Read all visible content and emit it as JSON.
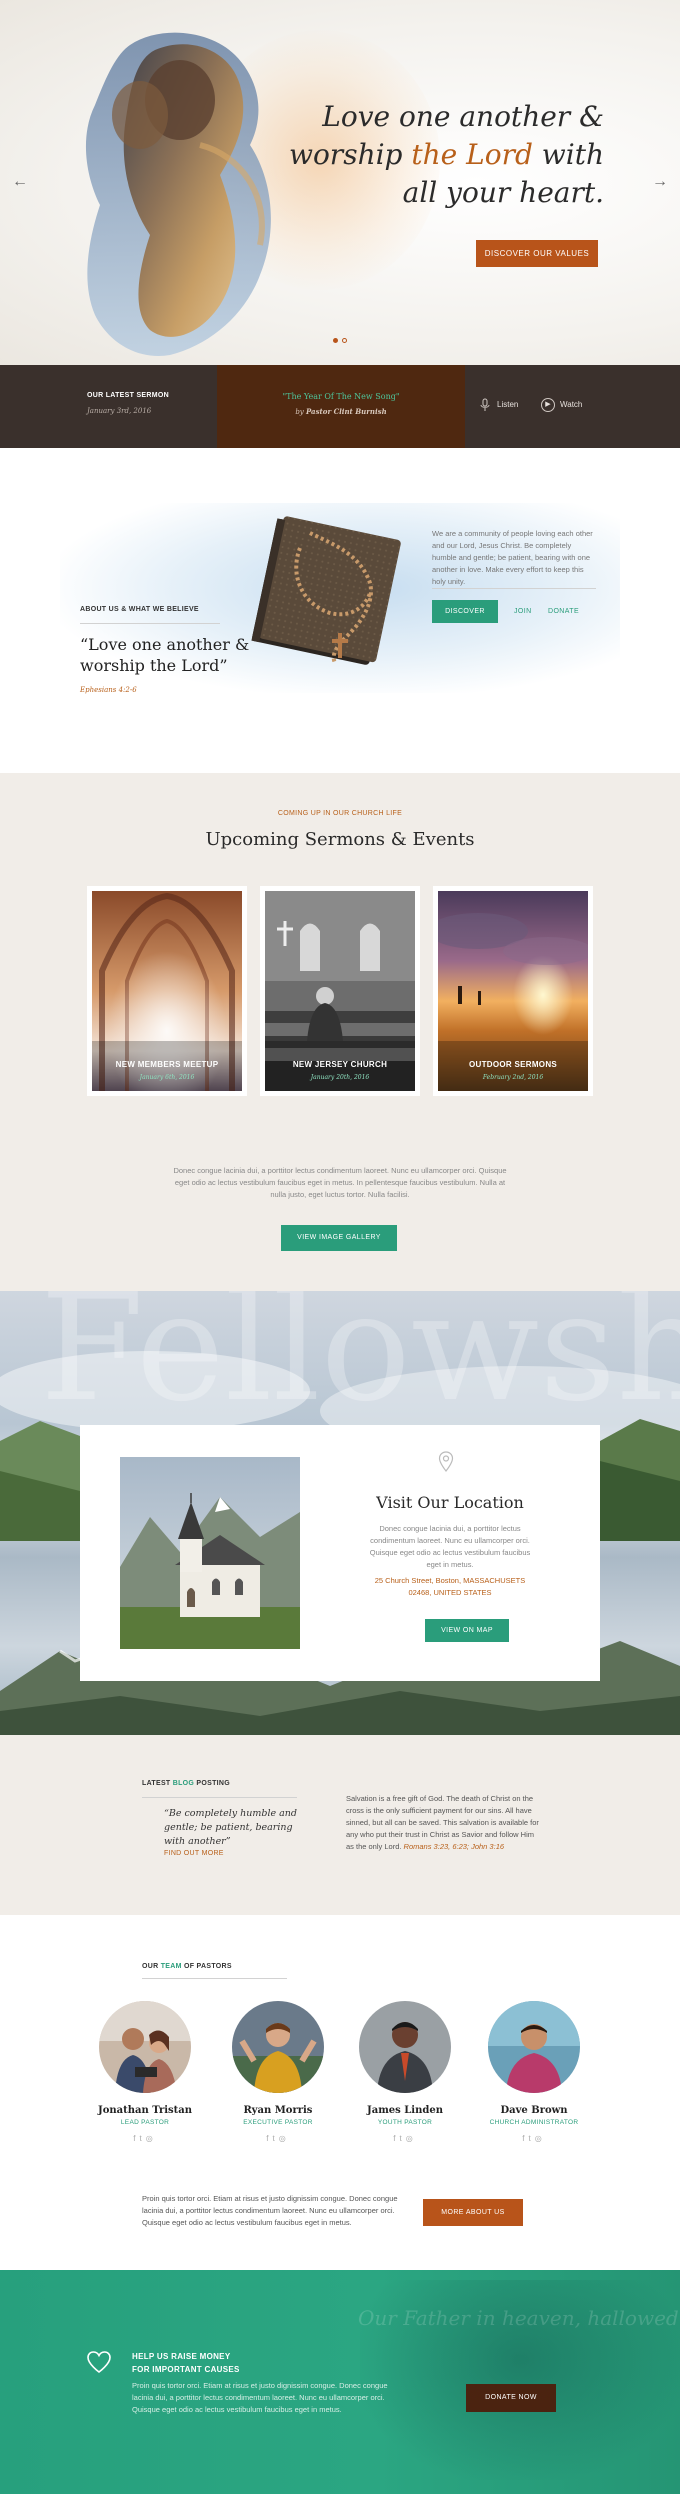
{
  "hero": {
    "title_line1": "Love one another &",
    "title_pre": "worship ",
    "title_accent": "the Lord",
    "title_post": " with",
    "title_line3": "all your heart.",
    "button_label": "DISCOVER OUR VALUES",
    "prev_arrow": "←",
    "next_arrow": "→"
  },
  "sermon_bar": {
    "label": "OUR LATEST SERMON",
    "date": "January 3rd, 2016",
    "title": "\"The Year Of The New Song\"",
    "by_prefix": "by ",
    "by_name": "Pastor Clint Burnish",
    "listen_label": "Listen",
    "watch_label": "Watch"
  },
  "about": {
    "label": "ABOUT US & WHAT WE BELIEVE",
    "quote": "“Love one another & worship the Lord”",
    "reference": "Ephesians 4:2-6",
    "text": "We are a community of people loving each other and our Lord, Jesus Christ. Be completely humble and gentle; be patient, bearing with one another in love. Make every effort to keep this holy unity.",
    "discover_label": "DISCOVER",
    "join_label": "JOIN",
    "donate_label": "DONATE"
  },
  "upcoming": {
    "label": "COMING UP IN OUR CHURCH LIFE",
    "title": "Upcoming Sermons & Events",
    "cards": [
      {
        "title": "NEW MEMBERS MEETUP",
        "date": "January 6th, 2016"
      },
      {
        "title": "NEW JERSEY CHURCH",
        "date": "January 20th, 2016"
      },
      {
        "title": "OUTDOOR SERMONS",
        "date": "February 2nd, 2016"
      }
    ],
    "text": "Donec congue lacinia dui, a porttitor lectus condimentum laoreet. Nunc eu ullamcorper orci. Quisque eget odio ac lectus vestibulum faucibus eget in metus. In pellentesque faucibus vestibulum. Nulla at nulla justo, eget luctus tortor. Nulla facilisi.",
    "gallery_label": "VIEW IMAGE GALLERY"
  },
  "location": {
    "background_word": "Fellowship",
    "title": "Visit Our Location",
    "text": "Donec congue lacinia dui, a porttitor lectus condimentum laoreet. Nunc eu ullamcorper orci. Quisque eget odio ac lectus vestibulum faucibus eget in metus.",
    "address_line1": "25 Church Street, Boston, MASSACHUSETS",
    "address_line2": "02468, UNITED STATES",
    "map_label": "VIEW ON MAP"
  },
  "blog": {
    "label_pre": "LATEST ",
    "label_accent": "BLOG",
    "label_post": " POSTING",
    "quote": "“Be completely humble and gentle; be patient, bearing with another”",
    "link_label": "FIND OUT MORE",
    "text": "Salvation is a free gift of God. The death of Christ on the cross is the only sufficient payment for our sins. All have sinned, but all can be saved. This salvation is available for any who put their trust in Christ as Savior and follow Him as the only Lord. ",
    "text_ref": "Romans 3:23, 6:23; John 3:16"
  },
  "pastors": {
    "label_pre": "OUR ",
    "label_accent": "TEAM",
    "label_post": " OF PASTORS",
    "list": [
      {
        "name": "Jonathan Tristan",
        "role": "LEAD PASTOR"
      },
      {
        "name": "Ryan Morris",
        "role": "EXECUTIVE PASTOR"
      },
      {
        "name": "James Linden",
        "role": "YOUTH PASTOR"
      },
      {
        "name": "Dave Brown",
        "role": "CHURCH ADMINISTRATOR"
      }
    ],
    "social": {
      "facebook": "f",
      "twitter": "t",
      "instagram": "◎"
    },
    "text": "Proin quis tortor orci. Etiam at risus et justo dignissim congue. Donec congue lacinia dui, a porttitor lectus condimentum laoreet. Nunc eu ullamcorper orci. Quisque eget odio ac lectus vestibulum faucibus eget in metus.",
    "more_label": "MORE ABOUT US"
  },
  "donate": {
    "script": "Our Father in heaven, hallowed be your name",
    "title_line1": "HELP US RAISE MONEY",
    "title_line2": "FOR IMPORTANT CAUSES",
    "text": "Proin quis tortor orci. Etiam at risus et justo dignissim congue. Donec congue lacinia dui, a porttitor lectus condimentum laoreet. Nunc eu ullamcorper orci. Quisque eget odio ac lectus vestibulum faucibus eget in metus.",
    "button_label": "DONATE NOW"
  },
  "colors": {
    "accent_orange": "#b8541a",
    "accent_green": "#2a9d7b",
    "dark_bar": "#3a302c",
    "sermon_highlight": "#4f2810"
  }
}
